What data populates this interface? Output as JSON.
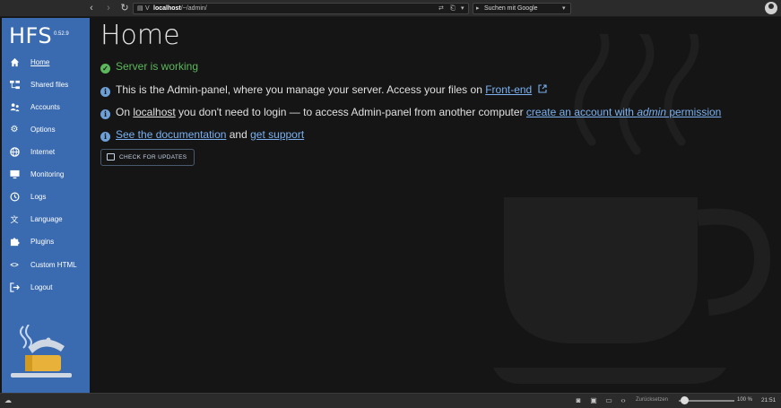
{
  "browser": {
    "url_host": "localhost",
    "url_path": "/~/admin/",
    "search_placeholder": "Suchen mit Google"
  },
  "sidebar": {
    "brand": "HFS",
    "version": "0.52.9",
    "items": [
      {
        "label": "Home",
        "icon": "home-icon",
        "active": true
      },
      {
        "label": "Shared files",
        "icon": "tree-icon"
      },
      {
        "label": "Accounts",
        "icon": "people-icon"
      },
      {
        "label": "Options",
        "icon": "gear-icon"
      },
      {
        "label": "Internet",
        "icon": "globe-icon"
      },
      {
        "label": "Monitoring",
        "icon": "monitor-icon"
      },
      {
        "label": "Logs",
        "icon": "history-icon"
      },
      {
        "label": "Language",
        "icon": "translate-icon"
      },
      {
        "label": "Plugins",
        "icon": "puzzle-icon"
      },
      {
        "label": "Custom HTML",
        "icon": "code-icon"
      },
      {
        "label": "Logout",
        "icon": "logout-icon"
      }
    ]
  },
  "main": {
    "title": "Home",
    "status": "Server is working",
    "line1": {
      "text": "This is the Admin-panel, where you manage your server. Access your files on ",
      "link": "Front-end"
    },
    "line2": {
      "pre": "On ",
      "host": "localhost",
      "mid": " you don't need to login — to access Admin-panel from another computer ",
      "link_a": "create an account with ",
      "link_em": "admin",
      "link_b": " permission"
    },
    "line3": {
      "link1": "See the documentation",
      "and": " and ",
      "link2": "get support"
    },
    "check_button": "CHECK FOR UPDATES"
  },
  "statusbar": {
    "reset_label": "Zurücksetzen",
    "zoom": "100 %",
    "time": "21:51"
  },
  "colors": {
    "sidebar": "#3a6bb0",
    "link": "#7ab0f0",
    "ok": "#5cb85c",
    "background": "#151515"
  }
}
